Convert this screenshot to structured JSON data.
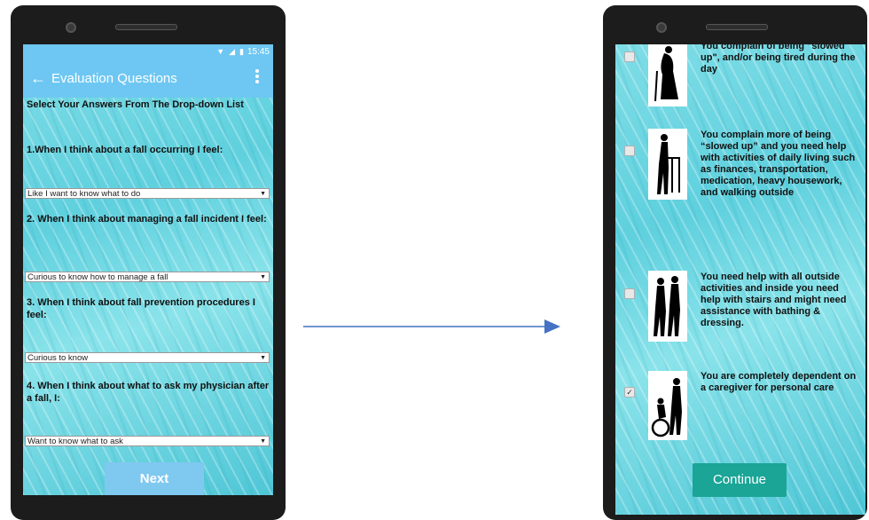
{
  "left_phone": {
    "status_bar": {
      "time": "15:45",
      "icons": [
        "wifi-icon",
        "signal-icon",
        "battery-icon"
      ]
    },
    "app_bar": {
      "title": "Evaluation Questions",
      "back_icon": "arrow-left-icon",
      "menu_icon": "more-vert-icon"
    },
    "instruction": "Select Your Answers From The Drop-down List",
    "questions": [
      {
        "text": "1.When I think about a fall occurring I feel:",
        "selected": "Like I want to know what to do"
      },
      {
        "text": "2. When I think about managing a fall incident I feel:",
        "selected": "Curious to know how to manage a fall"
      },
      {
        "text": "3. When I think about fall prevention procedures I feel:",
        "selected": "Curious to know"
      },
      {
        "text": "4. When I think about what to ask my physician after a fall, I:",
        "selected": "Want to know what to ask"
      }
    ],
    "next_label": "Next"
  },
  "right_phone": {
    "items": [
      {
        "text": "You complain of being \"slowed up\", and/or being tired during the day",
        "checked": false,
        "figure_icon": "elderly-cane-icon"
      },
      {
        "text": "You complain more of being “slowed up” and you need help with activities of daily living such as finances, transportation, medication, heavy housework, and walking outside",
        "checked": false,
        "figure_icon": "walker-icon"
      },
      {
        "text": "You need help with all outside activities and inside you need help with stairs and might need assistance with bathing & dressing.",
        "checked": false,
        "figure_icon": "assisted-walking-icon"
      },
      {
        "text": "You are completely dependent on a caregiver for personal care",
        "checked": true,
        "figure_icon": "wheelchair-caregiver-icon"
      }
    ],
    "continue_label": "Continue"
  },
  "colors": {
    "app_bar": "#6ec7f2",
    "next_button": "#7fc8f0",
    "continue_button": "#1aa596",
    "arrow": "#4472c4"
  }
}
